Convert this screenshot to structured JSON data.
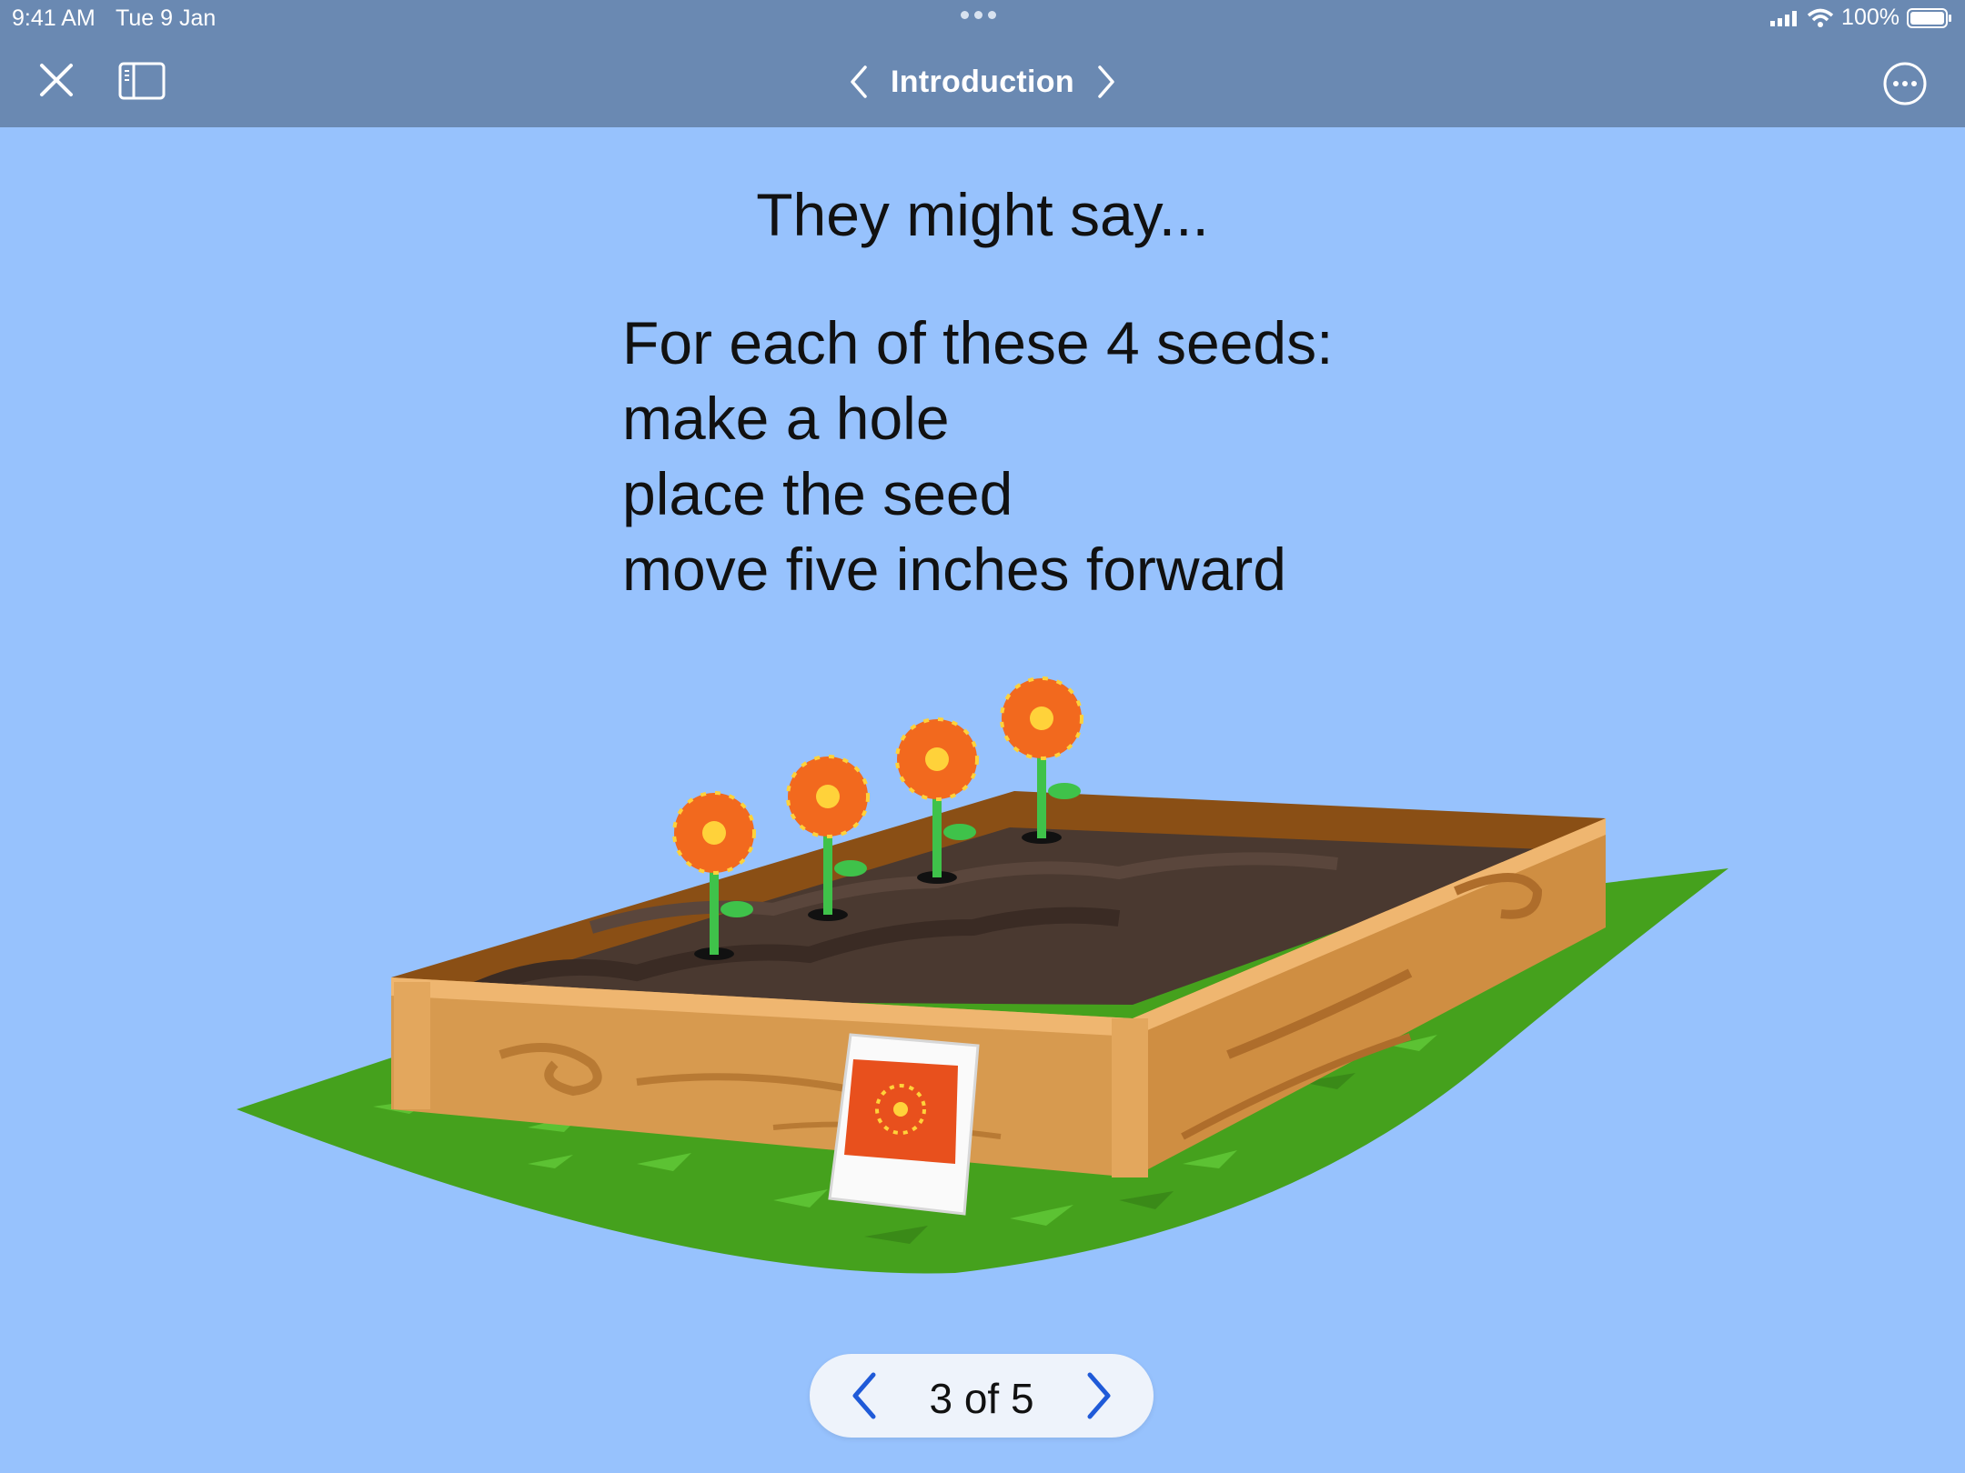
{
  "status_bar": {
    "time": "9:41 AM",
    "date": "Tue 9 Jan",
    "battery": "100%"
  },
  "toolbar": {
    "title": "Introduction"
  },
  "content": {
    "heading": "They might say...",
    "lines": [
      "For each of these 4 seeds:",
      "make a hole",
      "place the seed",
      "move five inches forward"
    ]
  },
  "pager": {
    "label": "3 of 5"
  },
  "colors": {
    "background": "#97c2fd",
    "toolbar": "#6a89b2",
    "pager_chevron": "#1f5ad8"
  },
  "icons": {
    "close": "close-icon",
    "sidebar": "sidebar-toggle-icon",
    "more": "more-icon",
    "prev": "chevron-left-icon",
    "next": "chevron-right-icon"
  }
}
